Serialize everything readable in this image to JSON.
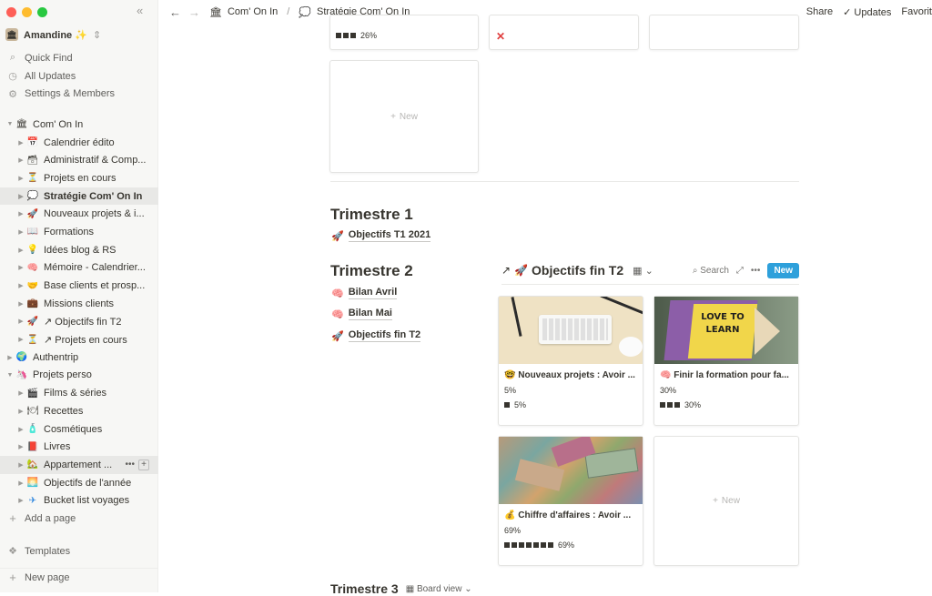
{
  "sidebar": {
    "workspace": "Amandine ✨",
    "top_nav": [
      {
        "icon": "search-icon",
        "glyph": "⌕",
        "label": "Quick Find"
      },
      {
        "icon": "clock-icon",
        "glyph": "◷",
        "label": "All Updates"
      },
      {
        "icon": "gear-icon",
        "glyph": "⚙",
        "label": "Settings & Members"
      }
    ],
    "tree": [
      {
        "label": "Com' On In",
        "glyph": "🏛"
      },
      {
        "label": "Calendrier édito",
        "glyph": "📅"
      },
      {
        "label": "Administratif & Comp...",
        "glyph": "🗃"
      },
      {
        "label": "Projets en cours",
        "glyph": "⏳"
      },
      {
        "label": "Stratégie Com' On In",
        "glyph": "💭"
      },
      {
        "label": "Nouveaux projets & i...",
        "glyph": "🚀"
      },
      {
        "label": "Formations",
        "glyph": "📖"
      },
      {
        "label": "Idées blog & RS",
        "glyph": "💡"
      },
      {
        "label": "Mémoire - Calendrier...",
        "glyph": "🧠"
      },
      {
        "label": "Base clients et prosp...",
        "glyph": "🤝"
      },
      {
        "label": "Missions clients",
        "glyph": "💼"
      },
      {
        "label": "↗ Objectifs fin T2",
        "glyph": "🚀"
      },
      {
        "label": "↗ Projets en cours",
        "glyph": "⏳"
      },
      {
        "label": "Authentrip",
        "glyph": "🌍"
      },
      {
        "label": "Projets perso",
        "glyph": "🦄"
      },
      {
        "label": "Films & séries",
        "glyph": "🎬"
      },
      {
        "label": "Recettes",
        "glyph": "🍽"
      },
      {
        "label": "Cosmétiques",
        "glyph": "🧴"
      },
      {
        "label": "Livres",
        "glyph": "📕"
      },
      {
        "label": "Appartement ...",
        "glyph": "🏡"
      },
      {
        "label": "Objectifs de l'année",
        "glyph": "🌅"
      },
      {
        "label": "Bucket list voyages",
        "glyph": "✈"
      }
    ],
    "add_page": "Add a page",
    "templates": "Templates",
    "new_page": "New page"
  },
  "topbar": {
    "crumb1": "Com' On In",
    "crumb2": "Stratégie Com' On In",
    "share": "Share",
    "updates": "Updates",
    "favorite": "Favorit"
  },
  "main": {
    "top_card1_progress": "26%",
    "new_label": "New",
    "trimestre1": "Trimestre 1",
    "t1_link": "Objectifs T1 2021",
    "trimestre2": "Trimestre 2",
    "t2_links": [
      "Bilan Avril",
      "Bilan Mai",
      "Objectifs fin T2"
    ],
    "db_title": "Objectifs fin T2",
    "search": "Search",
    "new_btn": "New",
    "cards": [
      {
        "title": "Nouveaux projets : Avoir ...",
        "prop": "5%",
        "bar": "5%",
        "progress": 0.05
      },
      {
        "title": "Finir la formation pour fa...",
        "prop": "30%",
        "bar": "30%",
        "progress": 0.3
      },
      {
        "title": "Chiffre d'affaires : Avoir ...",
        "prop": "69%",
        "bar": "69%",
        "progress": 0.69
      }
    ],
    "love_text": "LOVE TO LEARN",
    "trimestre3": "Trimestre 3",
    "board_view": "Board view"
  }
}
